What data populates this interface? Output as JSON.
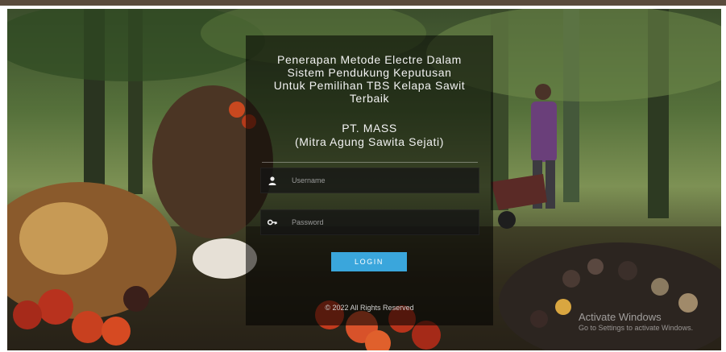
{
  "header": {
    "title_lines": [
      "Penerapan Metode Electre Dalam",
      "Sistem Pendukung Keputusan",
      "Untuk Pemilihan TBS Kelapa Sawit",
      "Terbaik"
    ],
    "company_lines": [
      "PT. MASS",
      "(Mitra Agung Sawita Sejati)"
    ]
  },
  "form": {
    "username": {
      "placeholder": "Username",
      "icon": "user-icon"
    },
    "password": {
      "placeholder": "Password",
      "icon": "key-icon"
    },
    "login_label": "LOGIN"
  },
  "footer": {
    "text": "© 2022 All Rights Reserved"
  },
  "watermark": {
    "line1": "Activate Windows",
    "line2": "Go to Settings to activate Windows."
  },
  "colors": {
    "accent": "#3aa6dc",
    "panel_overlay": "rgba(0,0,0,0.55)"
  }
}
